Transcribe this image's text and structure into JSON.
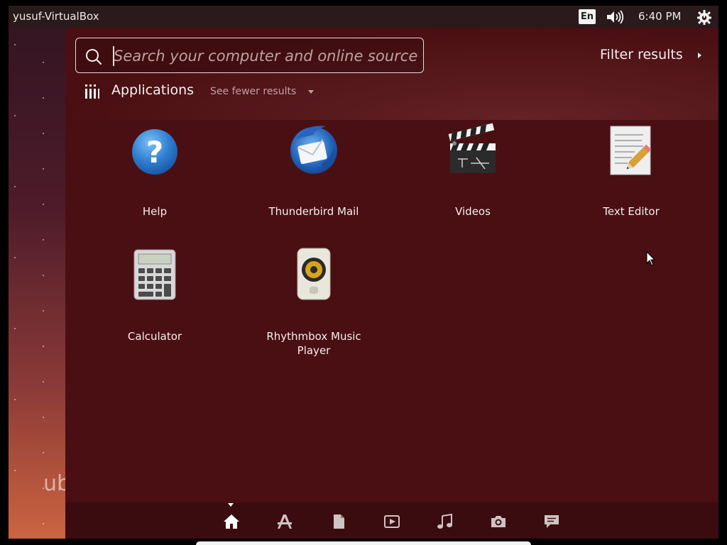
{
  "top_panel": {
    "window_title": "yusuf-VirtualBox",
    "keyboard_layout": "En",
    "clock": "6:40 PM",
    "icons": [
      "volume-icon",
      "power-icon"
    ]
  },
  "launcher": {
    "wordmark": "ub"
  },
  "dash": {
    "search": {
      "value": "",
      "placeholder": "Search your computer and online sources"
    },
    "filter_label": "Filter results",
    "category": {
      "title": "Applications",
      "toggle_label": "See fewer results",
      "icon": "applications-icon"
    },
    "apps": [
      {
        "label": "Help",
        "icon": "help-icon"
      },
      {
        "label": "Thunderbird Mail",
        "icon": "thunderbird-icon"
      },
      {
        "label": "Videos",
        "icon": "clapperboard-icon"
      },
      {
        "label": "Text Editor",
        "icon": "text-editor-icon"
      },
      {
        "label": "Calculator",
        "icon": "calculator-icon"
      },
      {
        "label": "Rhythmbox Music Player",
        "icon": "speaker-icon"
      }
    ],
    "lenses": [
      {
        "name": "home",
        "icon": "home-icon",
        "active": true
      },
      {
        "name": "applications",
        "icon": "applications-lens-icon",
        "active": false
      },
      {
        "name": "files",
        "icon": "file-icon",
        "active": false
      },
      {
        "name": "video",
        "icon": "video-icon",
        "active": false
      },
      {
        "name": "music",
        "icon": "music-icon",
        "active": false
      },
      {
        "name": "photos",
        "icon": "camera-icon",
        "active": false
      },
      {
        "name": "social",
        "icon": "chat-icon",
        "active": false
      }
    ]
  },
  "colors": {
    "dash_background": "#4a0f12",
    "panel_background": "#2a1a1c",
    "text": "#f2efef",
    "accent_blue": "#2f7fd0"
  }
}
